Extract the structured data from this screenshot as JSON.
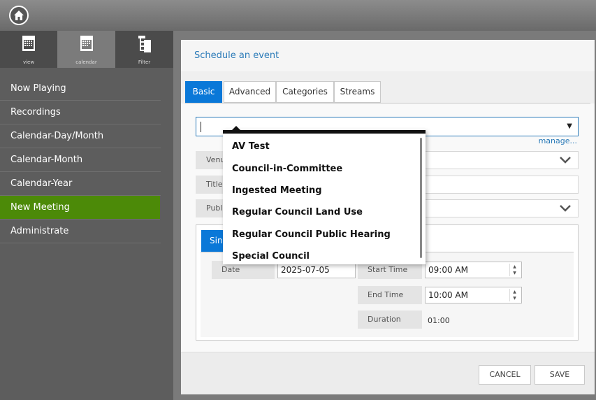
{
  "sidebar": {
    "view_tabs": [
      {
        "label": "view",
        "icon": "grid-calendar-icon"
      },
      {
        "label": "calendar",
        "icon": "calendar-icon"
      },
      {
        "label": "Filter",
        "icon": "tree-filter-icon"
      }
    ],
    "nav": [
      {
        "label": "Now Playing",
        "active": false
      },
      {
        "label": "Recordings",
        "active": false
      },
      {
        "label": "Calendar-Day/Month",
        "active": false
      },
      {
        "label": "Calendar-Month",
        "active": false
      },
      {
        "label": "Calendar-Year",
        "active": false
      },
      {
        "label": "New Meeting",
        "active": true
      },
      {
        "label": "Administrate",
        "active": false
      }
    ]
  },
  "main": {
    "title": "Schedule an event",
    "tabs": [
      "Basic",
      "Advanced",
      "Categories",
      "Streams"
    ],
    "active_tab": "Basic",
    "combo": {
      "value": "",
      "manage_link": "manage..."
    },
    "fields": {
      "venue_label": "Venu",
      "title_label": "Title",
      "public_label": "Publi"
    },
    "schedule": {
      "tab_label": "Sing",
      "date_label": "Date",
      "date_value": "2025-07-05",
      "start_label": "Start Time",
      "start_value": "09:00 AM",
      "end_label": "End Time",
      "end_value": "10:00 AM",
      "duration_label": "Duration",
      "duration_value": "01:00"
    },
    "buttons": {
      "cancel": "CANCEL",
      "save": "SAVE"
    }
  },
  "dropdown": {
    "options": [
      "AV Test",
      "Council-in-Committee",
      "Ingested Meeting",
      "Regular Council Land Use",
      "Regular Council Public Hearing",
      "Special Council"
    ]
  },
  "colors": {
    "accent": "#0a78d8",
    "active_nav": "#4c8a08",
    "link": "#2a7ab8"
  }
}
